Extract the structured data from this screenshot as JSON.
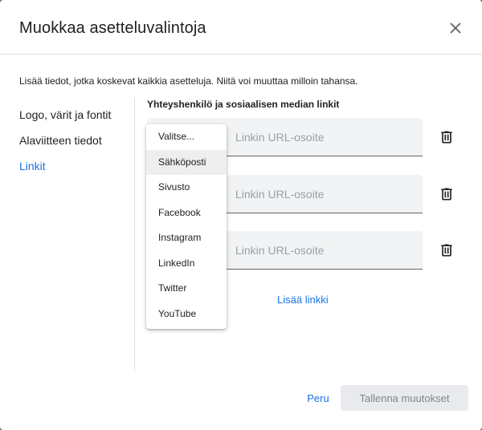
{
  "dialog": {
    "title": "Muokkaa asetteluvalintoja",
    "description": "Lisää tiedot, jotka koskevat kaikkia asetteluja. Niitä voi muuttaa milloin tahansa."
  },
  "nav": {
    "items": [
      {
        "label": "Logo, värit ja fontit"
      },
      {
        "label": "Alaviitteen tiedot"
      },
      {
        "label": "Linkit",
        "active": true
      }
    ]
  },
  "links_section": {
    "title": "Yhteyshenkilö ja sosiaalisen median linkit",
    "url_placeholder": "Linkin URL-osoite",
    "add_link_label": "Lisää linkki"
  },
  "dropdown": {
    "options": [
      "Valitse...",
      "Sähköposti",
      "Sivusto",
      "Facebook",
      "Instagram",
      "LinkedIn",
      "Twitter",
      "YouTube"
    ],
    "highlighted": "Sähköposti"
  },
  "footer": {
    "cancel_label": "Peru",
    "save_label": "Tallenna muutokset"
  },
  "colors": {
    "accent": "#1a73e8",
    "field_bg": "#f1f3f4",
    "disabled_bg": "#e8eaed"
  },
  "icons": {
    "close": "close-icon",
    "delete": "trash-icon"
  }
}
